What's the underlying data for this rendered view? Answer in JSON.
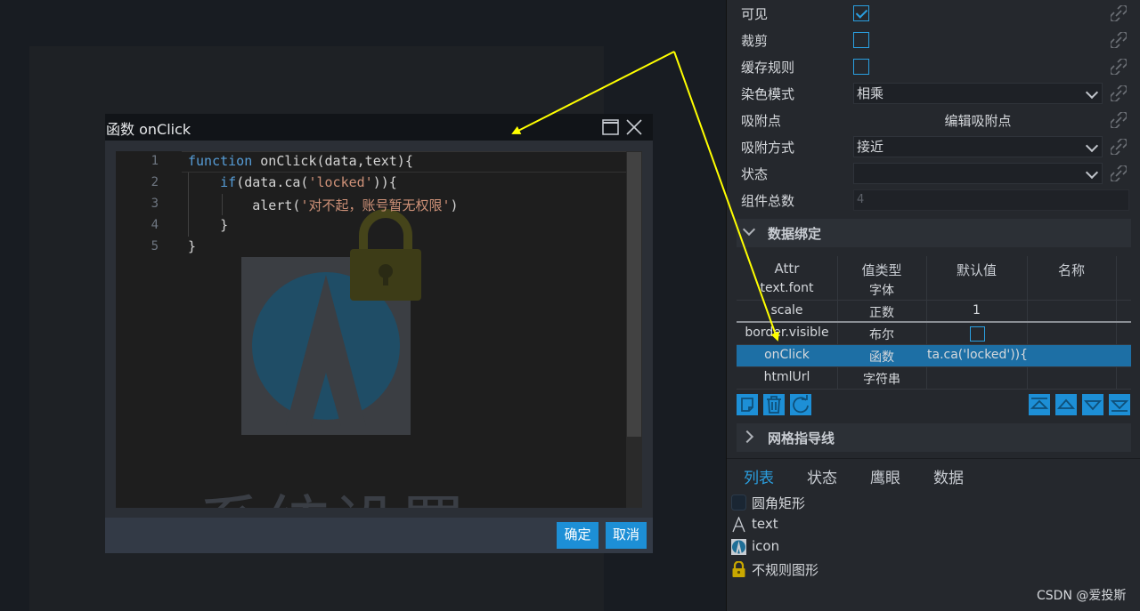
{
  "dialog": {
    "title": "函数 onClick",
    "ok_label": "确定",
    "cancel_label": "取消"
  },
  "editor": {
    "line_numbers": [
      "1",
      "2",
      "3",
      "4",
      "5"
    ],
    "lines": [
      [
        {
          "cls": "kw",
          "t": "function"
        },
        {
          "cls": "",
          "t": " onClick(data,text){"
        }
      ],
      [
        {
          "cls": "",
          "t": "    "
        },
        {
          "cls": "kw",
          "t": "if"
        },
        {
          "cls": "",
          "t": "(data.ca("
        },
        {
          "cls": "str",
          "t": "'locked'"
        },
        {
          "cls": "",
          "t": ")){"
        }
      ],
      [
        {
          "cls": "",
          "t": "        alert("
        },
        {
          "cls": "str",
          "t": "'对不起，账号暂无权限'"
        },
        {
          "cls": "",
          "t": ")"
        }
      ],
      [
        {
          "cls": "",
          "t": "    }"
        }
      ],
      [
        {
          "cls": "",
          "t": "}"
        }
      ]
    ],
    "watermark_text": "系统设置"
  },
  "properties": {
    "visible_label": "可见",
    "clip_label": "裁剪",
    "cache_label": "缓存规则",
    "blend_label": "染色模式",
    "blend_value": "相乘",
    "anchor_label": "吸附点",
    "anchor_value": "编辑吸附点",
    "anchor_mode_label": "吸附方式",
    "anchor_mode_value": "接近",
    "state_label": "状态",
    "state_value": "",
    "count_label": "组件总数",
    "count_placeholder": "4"
  },
  "sections": {
    "data_binding": "数据绑定",
    "grid_guides": "网格指导线"
  },
  "table": {
    "headers": [
      "Attr",
      "值类型",
      "默认值",
      "名称"
    ],
    "rows": [
      {
        "attr": "text.font",
        "type": "字体",
        "default": ""
      },
      {
        "attr": "scale",
        "type": "正数",
        "default": "1"
      },
      {
        "attr": "border.visible",
        "type": "布尔",
        "default": ""
      },
      {
        "attr": "onClick",
        "type": "函数",
        "default": "ta.ca('locked')){"
      },
      {
        "attr": "htmlUrl",
        "type": "字符串",
        "default": ""
      }
    ]
  },
  "tabs": [
    "列表",
    "状态",
    "鹰眼",
    "数据"
  ],
  "tree": [
    {
      "label": "圆角矩形",
      "icon": "rounded-rect-icon"
    },
    {
      "label": "text",
      "icon": "text-icon"
    },
    {
      "label": "icon",
      "icon": "image-icon"
    },
    {
      "label": "不规则图形",
      "icon": "lock-icon"
    }
  ],
  "credit": "CSDN @爱投斯",
  "colors": {
    "accent": "#1d8fd6",
    "selected_row": "#1d6fa5",
    "arrow": "#ffff00"
  }
}
